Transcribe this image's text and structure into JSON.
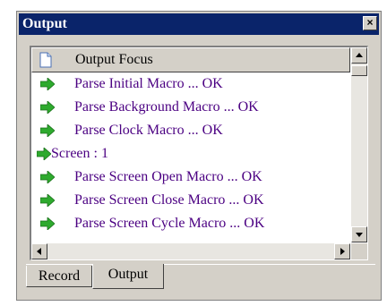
{
  "window": {
    "title": "Output",
    "close_label": "×"
  },
  "list": {
    "header": "Output Focus",
    "items": [
      {
        "text": "Parse Initial Macro ... OK",
        "indent": true
      },
      {
        "text": "Parse Background Macro ... OK",
        "indent": true
      },
      {
        "text": "Parse Clock Macro ... OK",
        "indent": true
      },
      {
        "text": "Screen : 1",
        "indent": false
      },
      {
        "text": "Parse Screen Open Macro ... OK",
        "indent": true
      },
      {
        "text": "Parse Screen Close Macro ... OK",
        "indent": true
      },
      {
        "text": "Parse Screen Cycle Macro ... OK",
        "indent": true
      }
    ]
  },
  "tabs": [
    {
      "label": "Record",
      "active": false
    },
    {
      "label": "Output",
      "active": true
    }
  ],
  "colors": {
    "titlebar": "#0a246a",
    "arrow": "#2eaa2e",
    "item_text": "#4b0082"
  },
  "icons": {
    "row_icon": "green-arrow-icon",
    "header_icon": "document-icon"
  }
}
